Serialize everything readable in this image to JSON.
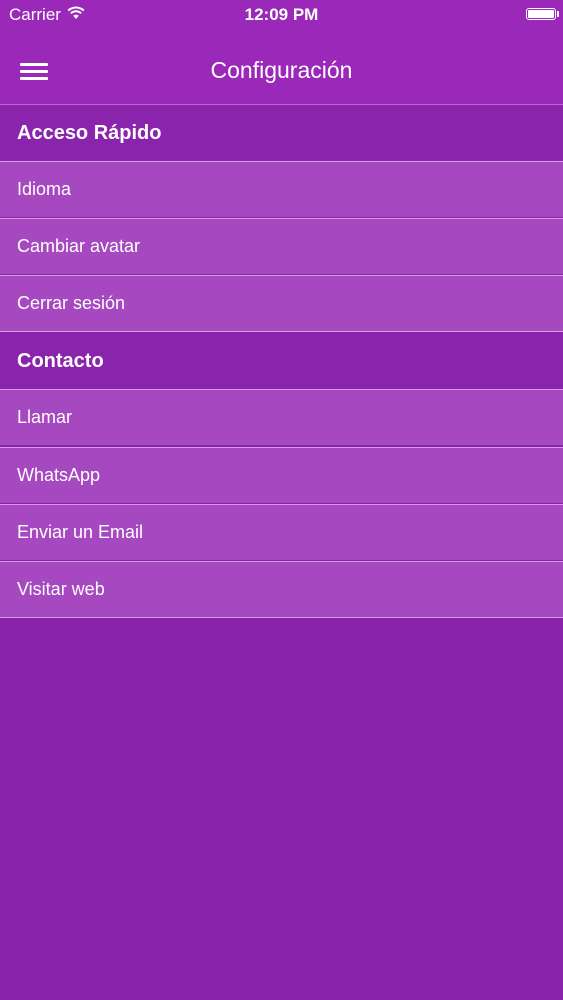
{
  "status_bar": {
    "carrier": "Carrier",
    "time": "12:09 PM",
    "wifi_icon": "wifi-icon",
    "battery_icon": "battery-icon"
  },
  "nav_bar": {
    "menu_icon": "hamburger-menu-icon",
    "title": "Configuración"
  },
  "sections": [
    {
      "header": "Acceso Rápido",
      "items": [
        "Idioma",
        "Cambiar avatar",
        "Cerrar sesión"
      ]
    },
    {
      "header": "Contacto",
      "items": [
        "Llamar",
        "WhatsApp",
        "Enviar un Email",
        "Visitar web"
      ]
    }
  ],
  "colors": {
    "background": "#8a23ab",
    "nav_bar": "#9a28b8",
    "row": "#a648bf",
    "separator": "#d2a0de",
    "text": "#ffffff"
  }
}
